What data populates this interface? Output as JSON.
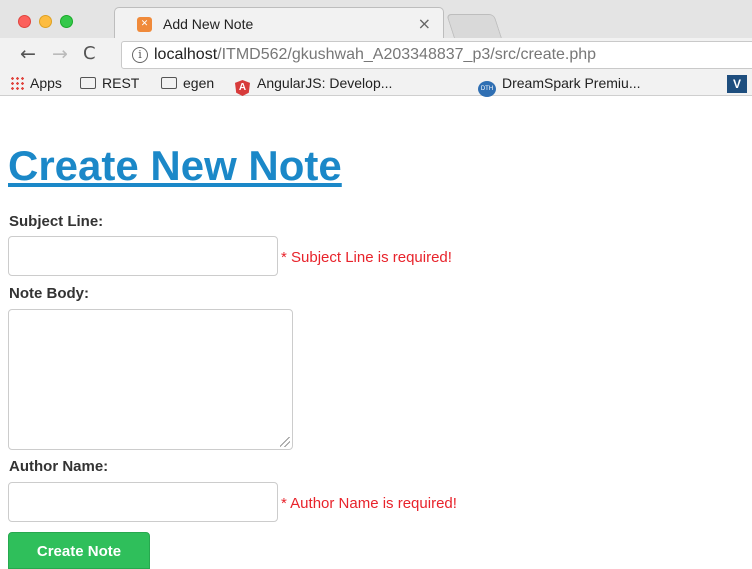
{
  "browser": {
    "tab": {
      "title": "Add New Note",
      "favicon": "xampp-icon",
      "close_glyph": "×"
    },
    "toolbar": {
      "back_glyph": "←",
      "forward_glyph": "→",
      "reload_glyph": "C",
      "url_host": "localhost",
      "url_path": "/ITMD562/gkushwah_A203348837_p3/src/create.php"
    },
    "bookmarks": [
      {
        "label": "Apps",
        "icon": "apps-grid-icon"
      },
      {
        "label": "REST",
        "icon": "folder-icon"
      },
      {
        "label": "egen",
        "icon": "folder-icon"
      },
      {
        "label": "AngularJS: Develop...",
        "icon": "angular-icon"
      },
      {
        "label": "DreamSpark Premiu...",
        "icon": "dreamspark-icon"
      }
    ]
  },
  "page": {
    "title": "Create New Note",
    "form": {
      "subject_label": "Subject Line:",
      "subject_value": "",
      "subject_error": "* Subject Line is required!",
      "body_label": "Note Body:",
      "body_value": "",
      "author_label": "Author Name:",
      "author_value": "",
      "author_error": "* Author Name is required!",
      "submit_label": "Create Note"
    }
  },
  "colors": {
    "title_link": "#1b88c8",
    "error_text": "#e8232b",
    "submit_button": "#2fbf5b"
  }
}
